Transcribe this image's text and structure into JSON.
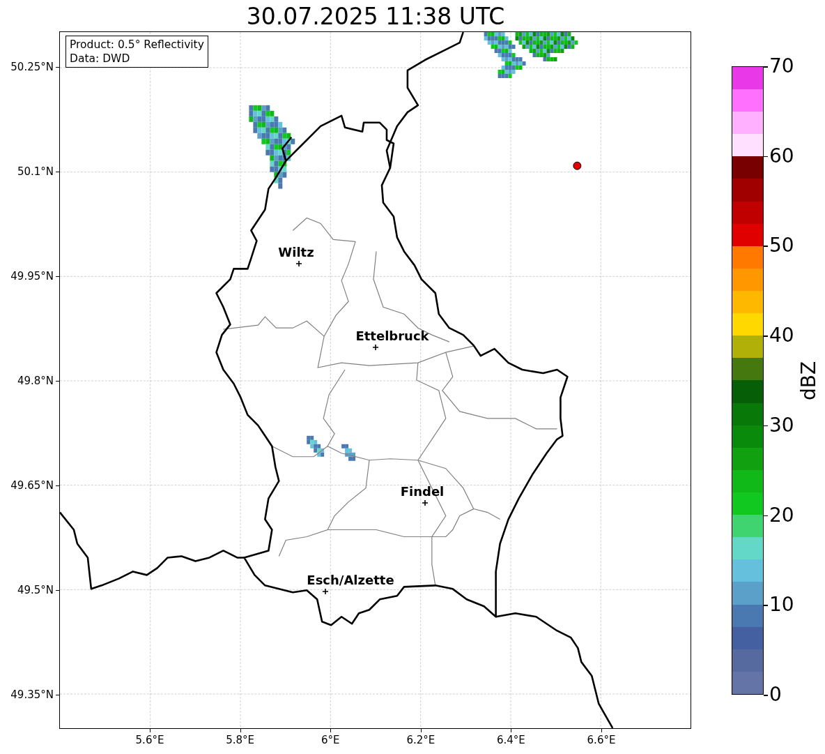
{
  "title": "30.07.2025 11:38 UTC",
  "info_box": [
    "Product: 0.5° Reflectivity",
    "Data: DWD"
  ],
  "cities": [
    {
      "name": "Wiltz"
    },
    {
      "name": "Ettelbruck"
    },
    {
      "name": "Findel"
    },
    {
      "name": "Esch/Alzette"
    }
  ],
  "radar_site": {
    "color": "#e00000"
  },
  "lon_ticks": [
    "5.6°E",
    "5.8°E",
    "6°E",
    "6.2°E",
    "6.4°E",
    "6.6°E"
  ],
  "lat_ticks": [
    "50.25°N",
    "50.1°N",
    "49.95°N",
    "49.8°N",
    "49.65°N",
    "49.5°N",
    "49.35°N"
  ],
  "colorbar": {
    "label": "dBZ",
    "ticks": [
      "70",
      "60",
      "50",
      "40",
      "30",
      "20",
      "10",
      "0"
    ],
    "bins": [
      {
        "color": "#6574a6"
      },
      {
        "color": "#566a9f"
      },
      {
        "color": "#4460a0"
      },
      {
        "color": "#4a78b0"
      },
      {
        "color": "#5aa0c8"
      },
      {
        "color": "#64c0dc"
      },
      {
        "color": "#64d8c8"
      },
      {
        "color": "#40d470"
      },
      {
        "color": "#10c820"
      },
      {
        "color": "#10b818"
      },
      {
        "color": "#10a010"
      },
      {
        "color": "#0a8a0a"
      },
      {
        "color": "#087808"
      },
      {
        "color": "#065e06"
      },
      {
        "color": "#467810"
      },
      {
        "color": "#b0b008"
      },
      {
        "color": "#ffd800"
      },
      {
        "color": "#ffb800"
      },
      {
        "color": "#ff9800"
      },
      {
        "color": "#ff7800"
      },
      {
        "color": "#e00000"
      },
      {
        "color": "#c00000"
      },
      {
        "color": "#a00000"
      },
      {
        "color": "#780000"
      },
      {
        "color": "#ffe0ff"
      },
      {
        "color": "#ffb0ff"
      },
      {
        "color": "#ff70ff"
      },
      {
        "color": "#e838e8"
      }
    ]
  }
}
